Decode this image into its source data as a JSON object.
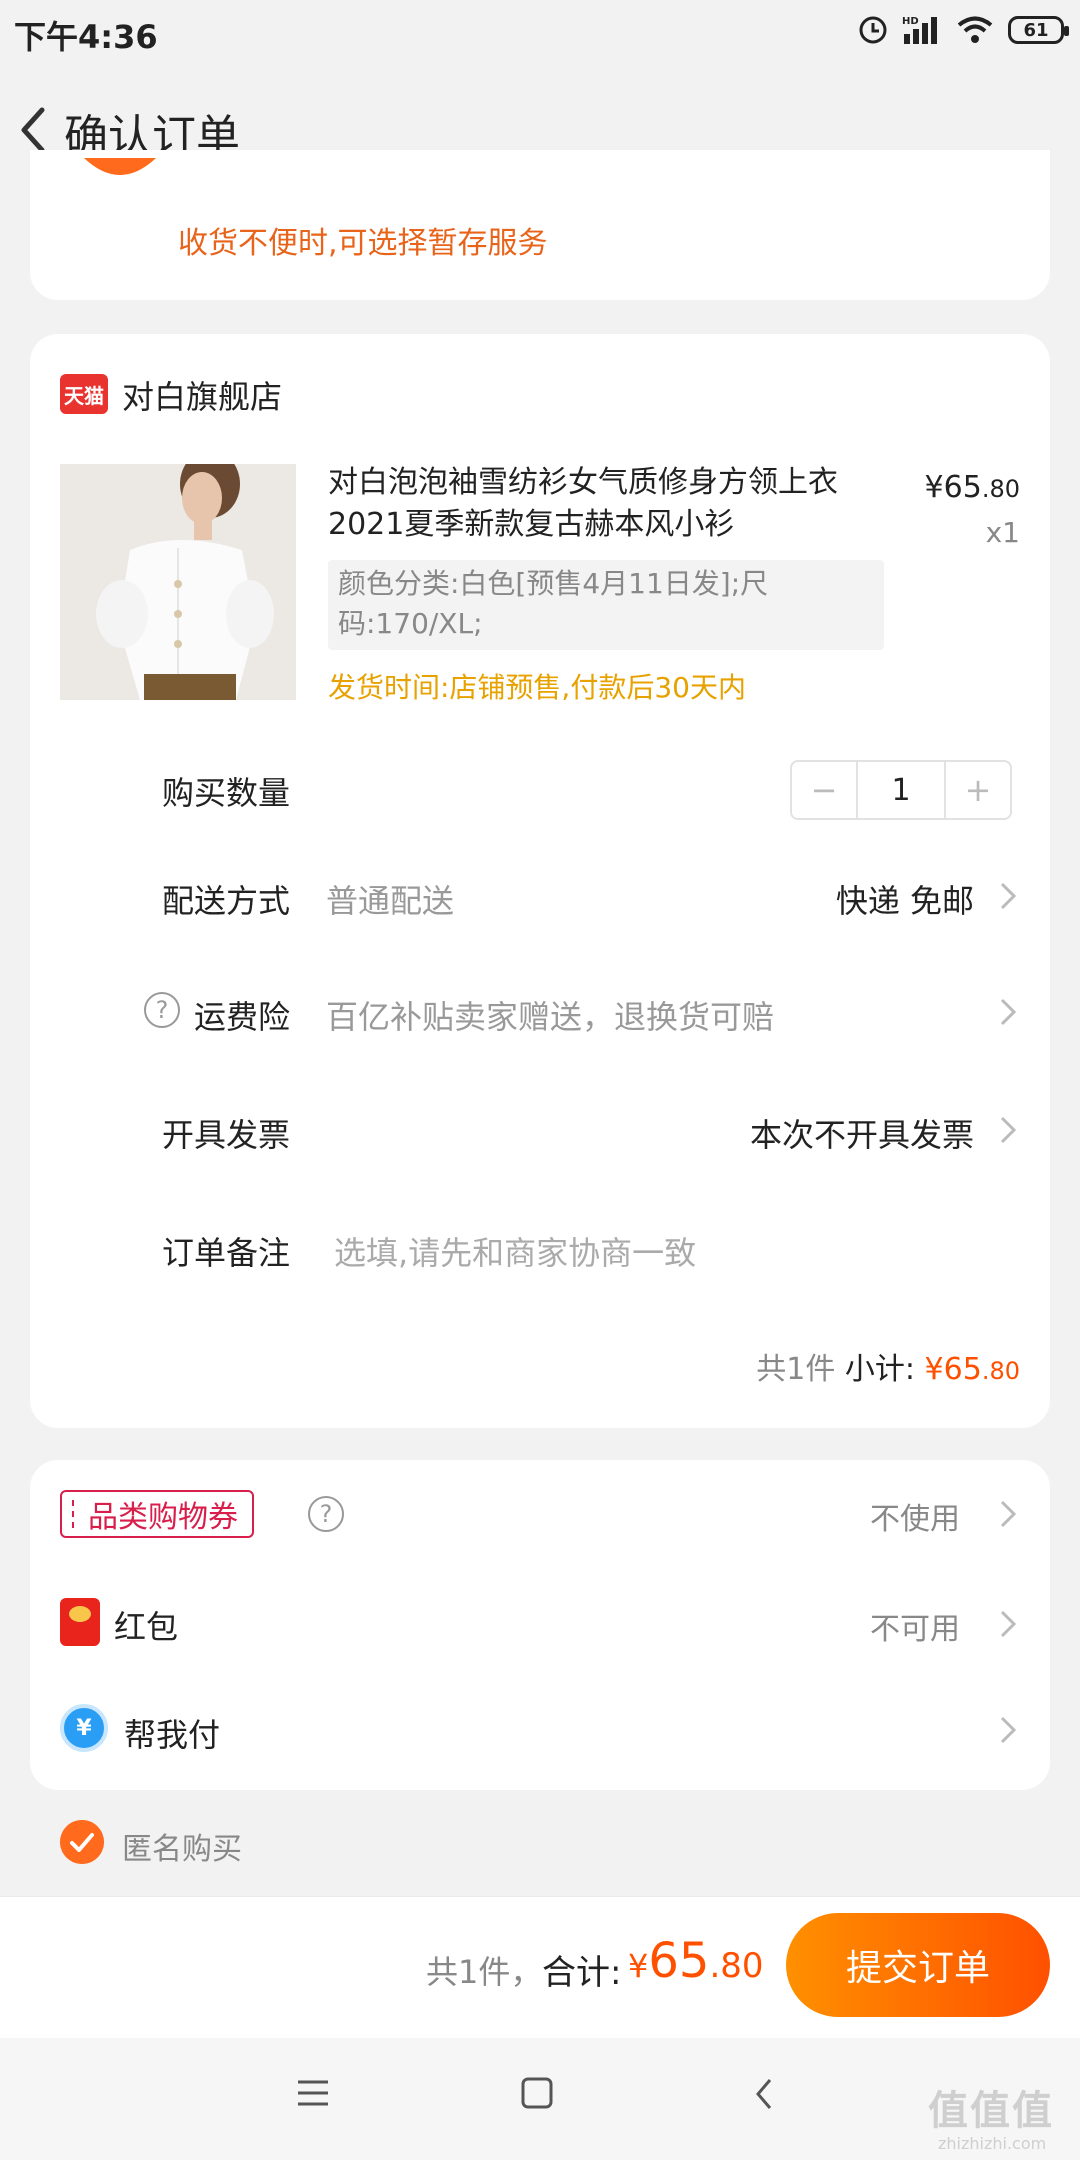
{
  "status_bar": {
    "time": "下午4:36",
    "battery": "61",
    "network": "HD"
  },
  "header": {
    "title": "确认订单"
  },
  "address": {
    "delivery_hint": "收货不便时,可选择暂存服务"
  },
  "store": {
    "badge": "天猫",
    "name": "对白旗舰店"
  },
  "product": {
    "title": "对白泡泡袖雪纺衫女气质修身方领上衣2021夏季新款复古赫本风小衫",
    "price_currency": "¥",
    "price_int": "65",
    "price_dec": ".80",
    "qty_text": "x1",
    "sku": "颜色分类:白色[预售4月11日发];尺码:170/XL;",
    "ship_time": "发货时间:店铺预售,付款后30天内"
  },
  "options": {
    "quantity_label": "购买数量",
    "quantity_value": "1",
    "quantity_minus": "−",
    "quantity_plus": "+",
    "delivery_label": "配送方式",
    "delivery_type": "普通配送",
    "delivery_value": "快递 免邮",
    "insurance_label": "运费险",
    "insurance_value": "百亿补贴卖家赠送，退换货可赔",
    "invoice_label": "开具发票",
    "invoice_value": "本次不开具发票",
    "note_label": "订单备注",
    "note_placeholder": "选填,请先和商家协商一致"
  },
  "subtotal": {
    "count": "共1件",
    "label": "小计:",
    "currency": "¥",
    "int": "65",
    "dec": ".80"
  },
  "benefits": {
    "coupon_label": "品类购物券",
    "coupon_value": "不使用",
    "redpacket_label": "红包",
    "redpacket_value": "不可用",
    "payfor_label": "帮我付",
    "payfor_icon": "¥"
  },
  "anonymous": {
    "label": "匿名购买",
    "checked": true
  },
  "footer": {
    "count": "共1件，",
    "total_label": "合计:",
    "currency": "¥",
    "int": "65",
    "dec": ".80",
    "submit": "提交订单"
  },
  "watermark": {
    "text": "值值值",
    "domain": "zhizhizhi.com"
  },
  "colors": {
    "accent": "#ff5000",
    "warning": "#e8a200",
    "coupon": "#d81e4a"
  }
}
